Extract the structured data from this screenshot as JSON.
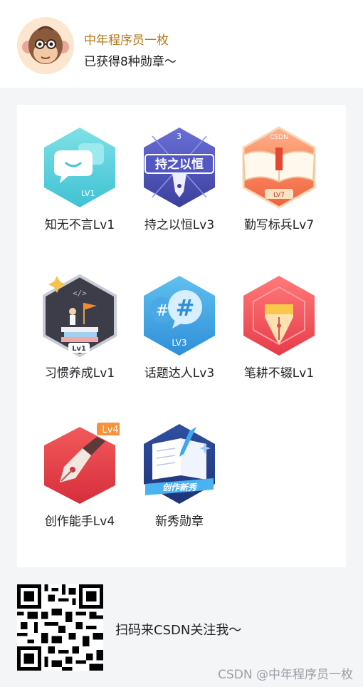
{
  "profile": {
    "username": "中年程序员一枚",
    "summary": "已获得8种勋章～",
    "avatar_icon": "monkey-avatar-icon"
  },
  "badges": [
    {
      "label": "知无不言Lv1",
      "icon": "chat-bubble-badge-icon",
      "level_text": "LV1"
    },
    {
      "label": "持之以恒Lv3",
      "icon": "pen-nib-persistence-badge-icon",
      "level_text": "3",
      "emblem_text": "持之以恒"
    },
    {
      "label": "勤写标兵Lv7",
      "icon": "open-book-csdn-badge-icon",
      "level_text": "LV7",
      "emblem_text": "CSDN"
    },
    {
      "label": "习惯养成Lv1",
      "icon": "habit-books-flag-badge-icon",
      "level_text": "Lv1",
      "emblem_text": "</>"
    },
    {
      "label": "话题达人Lv3",
      "icon": "hashtag-bubble-badge-icon",
      "level_text": "LV3"
    },
    {
      "label": "笔耕不辍Lv1",
      "icon": "red-pen-nib-badge-icon"
    },
    {
      "label": "创作能手Lv4",
      "icon": "fountain-pen-badge-icon",
      "level_text": "Lv4"
    },
    {
      "label": "新秀勋章",
      "icon": "notebook-creator-badge-icon",
      "emblem_text": "创作新秀"
    }
  ],
  "footer": {
    "qr_caption": "扫码来CSDN关注我～",
    "qr_icon": "qr-code-icon",
    "watermark": "CSDN @中年程序员一枚"
  },
  "colors": {
    "username": "#b5781b",
    "background": "#f4f5f7",
    "panel": "#ffffff"
  }
}
